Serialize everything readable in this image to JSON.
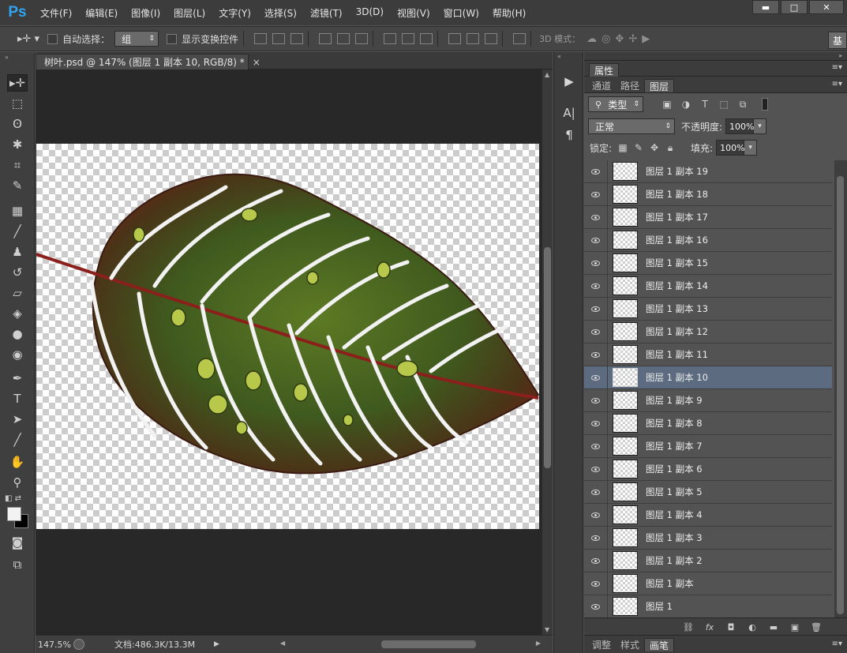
{
  "app": {
    "logo": "Ps"
  },
  "menu": [
    "文件(F)",
    "编辑(E)",
    "图像(I)",
    "图层(L)",
    "文字(Y)",
    "选择(S)",
    "滤镜(T)",
    "3D(D)",
    "视图(V)",
    "窗口(W)",
    "帮助(H)"
  ],
  "window_controls": {
    "minimize": "▬",
    "maximize": "□",
    "close": "✕"
  },
  "options": {
    "auto_select_label": "自动选择：",
    "auto_select_value": "组",
    "show_transform_label": "显示变换控件",
    "mode_3d_label": "3D 模式：",
    "workspace_label": "基"
  },
  "document": {
    "tab_title": "树叶.psd @ 147% (图层 1 副本 10, RGB/8) *",
    "tab_close": "×",
    "zoom": "147.5%",
    "doc_size": "文档:486.3K/13.3M"
  },
  "panels": {
    "properties_tab": "属性",
    "tabs": [
      "通道",
      "路径",
      "图层"
    ],
    "active_tab": "图层",
    "filter_kind": "类型",
    "blend_mode": "正常",
    "opacity_label": "不透明度:",
    "opacity_value": "100%",
    "lock_label": "锁定:",
    "fill_label": "填充:",
    "fill_value": "100%",
    "bottom_tabs": [
      "调整",
      "样式",
      "画笔"
    ],
    "active_bottom_tab": "画笔"
  },
  "layers": [
    {
      "name": "图层 1 副本 19",
      "selected": false
    },
    {
      "name": "图层 1 副本 18",
      "selected": false
    },
    {
      "name": "图层 1 副本 17",
      "selected": false
    },
    {
      "name": "图层 1 副本 16",
      "selected": false
    },
    {
      "name": "图层 1 副本 15",
      "selected": false
    },
    {
      "name": "图层 1 副本 14",
      "selected": false
    },
    {
      "name": "图层 1 副本 13",
      "selected": false
    },
    {
      "name": "图层 1 副本 12",
      "selected": false
    },
    {
      "name": "图层 1 副本 11",
      "selected": false
    },
    {
      "name": "图层 1 副本 10",
      "selected": true
    },
    {
      "name": "图层 1 副本 9",
      "selected": false
    },
    {
      "name": "图层 1 副本 8",
      "selected": false
    },
    {
      "name": "图层 1 副本 7",
      "selected": false
    },
    {
      "name": "图层 1 副本 6",
      "selected": false
    },
    {
      "name": "图层 1 副本 5",
      "selected": false
    },
    {
      "name": "图层 1 副本 4",
      "selected": false
    },
    {
      "name": "图层 1 副本 3",
      "selected": false
    },
    {
      "name": "图层 1 副本 2",
      "selected": false
    },
    {
      "name": "图层 1 副本",
      "selected": false
    },
    {
      "name": "图层 1",
      "selected": false
    }
  ],
  "colors": {
    "app_bg": "#535353",
    "menu_bg": "#3c3c3c",
    "selected_layer": "#5c6b7f",
    "ps_blue": "#2fa4f0",
    "leaf_green": "#3f5a1e",
    "leaf_red_edge": "#6b2318",
    "midrib": "#8a1f1b"
  }
}
